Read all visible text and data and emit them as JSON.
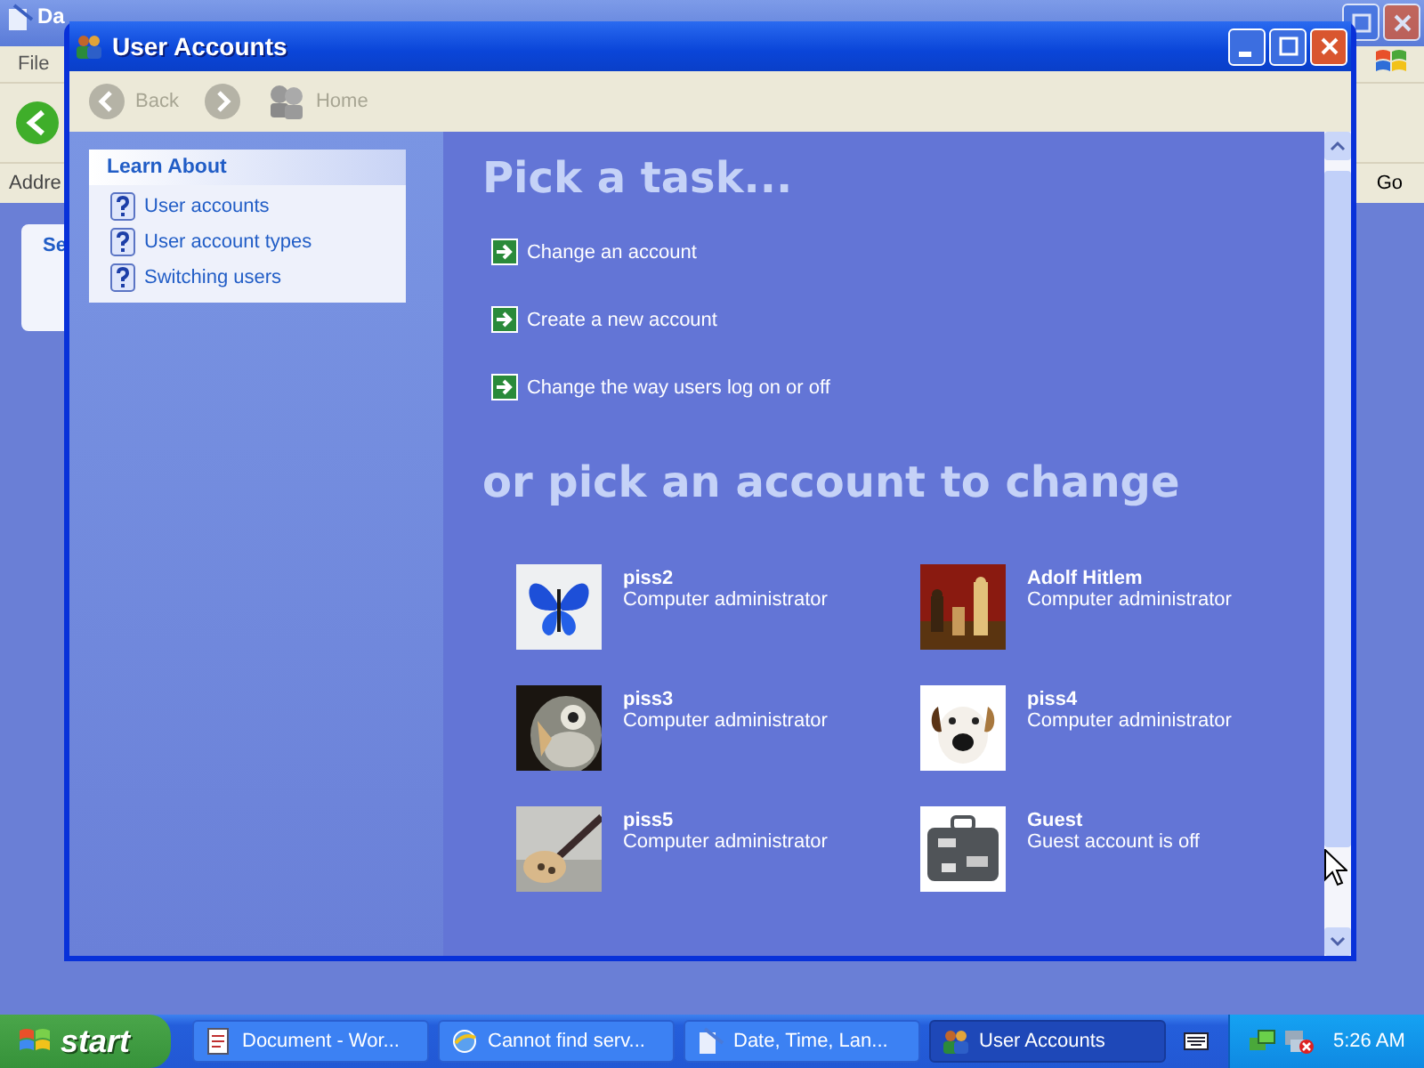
{
  "background_window": {
    "title": "Da",
    "menu": [
      "File"
    ],
    "address_label": "Addre",
    "panel_title": "Se",
    "go_button": "Go"
  },
  "window": {
    "title": "User Accounts"
  },
  "toolbar": [
    {
      "kind": "back",
      "label": "Back",
      "disabled": true
    },
    {
      "kind": "forward",
      "disabled": true
    },
    {
      "kind": "home",
      "label": "Home",
      "disabled": true
    }
  ],
  "learn_about": {
    "title": "Learn About",
    "items": [
      "User accounts",
      "User account types",
      "Switching users"
    ]
  },
  "task_heading": "Pick a task...",
  "tasks": [
    "Change an account",
    "Create a new account",
    "Change the way users log on or off"
  ],
  "account_heading": "or pick an account to change",
  "accounts": [
    {
      "name": "piss2",
      "type": "Computer administrator"
    },
    {
      "name": "Adolf Hitlem",
      "type": "Computer administrator"
    },
    {
      "name": "piss3",
      "type": "Computer administrator"
    },
    {
      "name": "piss4",
      "type": "Computer administrator"
    },
    {
      "name": "piss5",
      "type": "Computer administrator"
    },
    {
      "name": "Guest",
      "type": "Guest account is off"
    }
  ],
  "taskbar": {
    "start": "start",
    "buttons": [
      {
        "kind": "document",
        "label": "Document - Wor...",
        "selected": false
      },
      {
        "kind": "browser",
        "label": "Cannot find serv...",
        "selected": false
      },
      {
        "kind": "panel",
        "label": "Date, Time, Lan...",
        "selected": false
      },
      {
        "kind": "users",
        "label": "User Accounts",
        "selected": true
      }
    ],
    "clock": "5:26 AM"
  }
}
